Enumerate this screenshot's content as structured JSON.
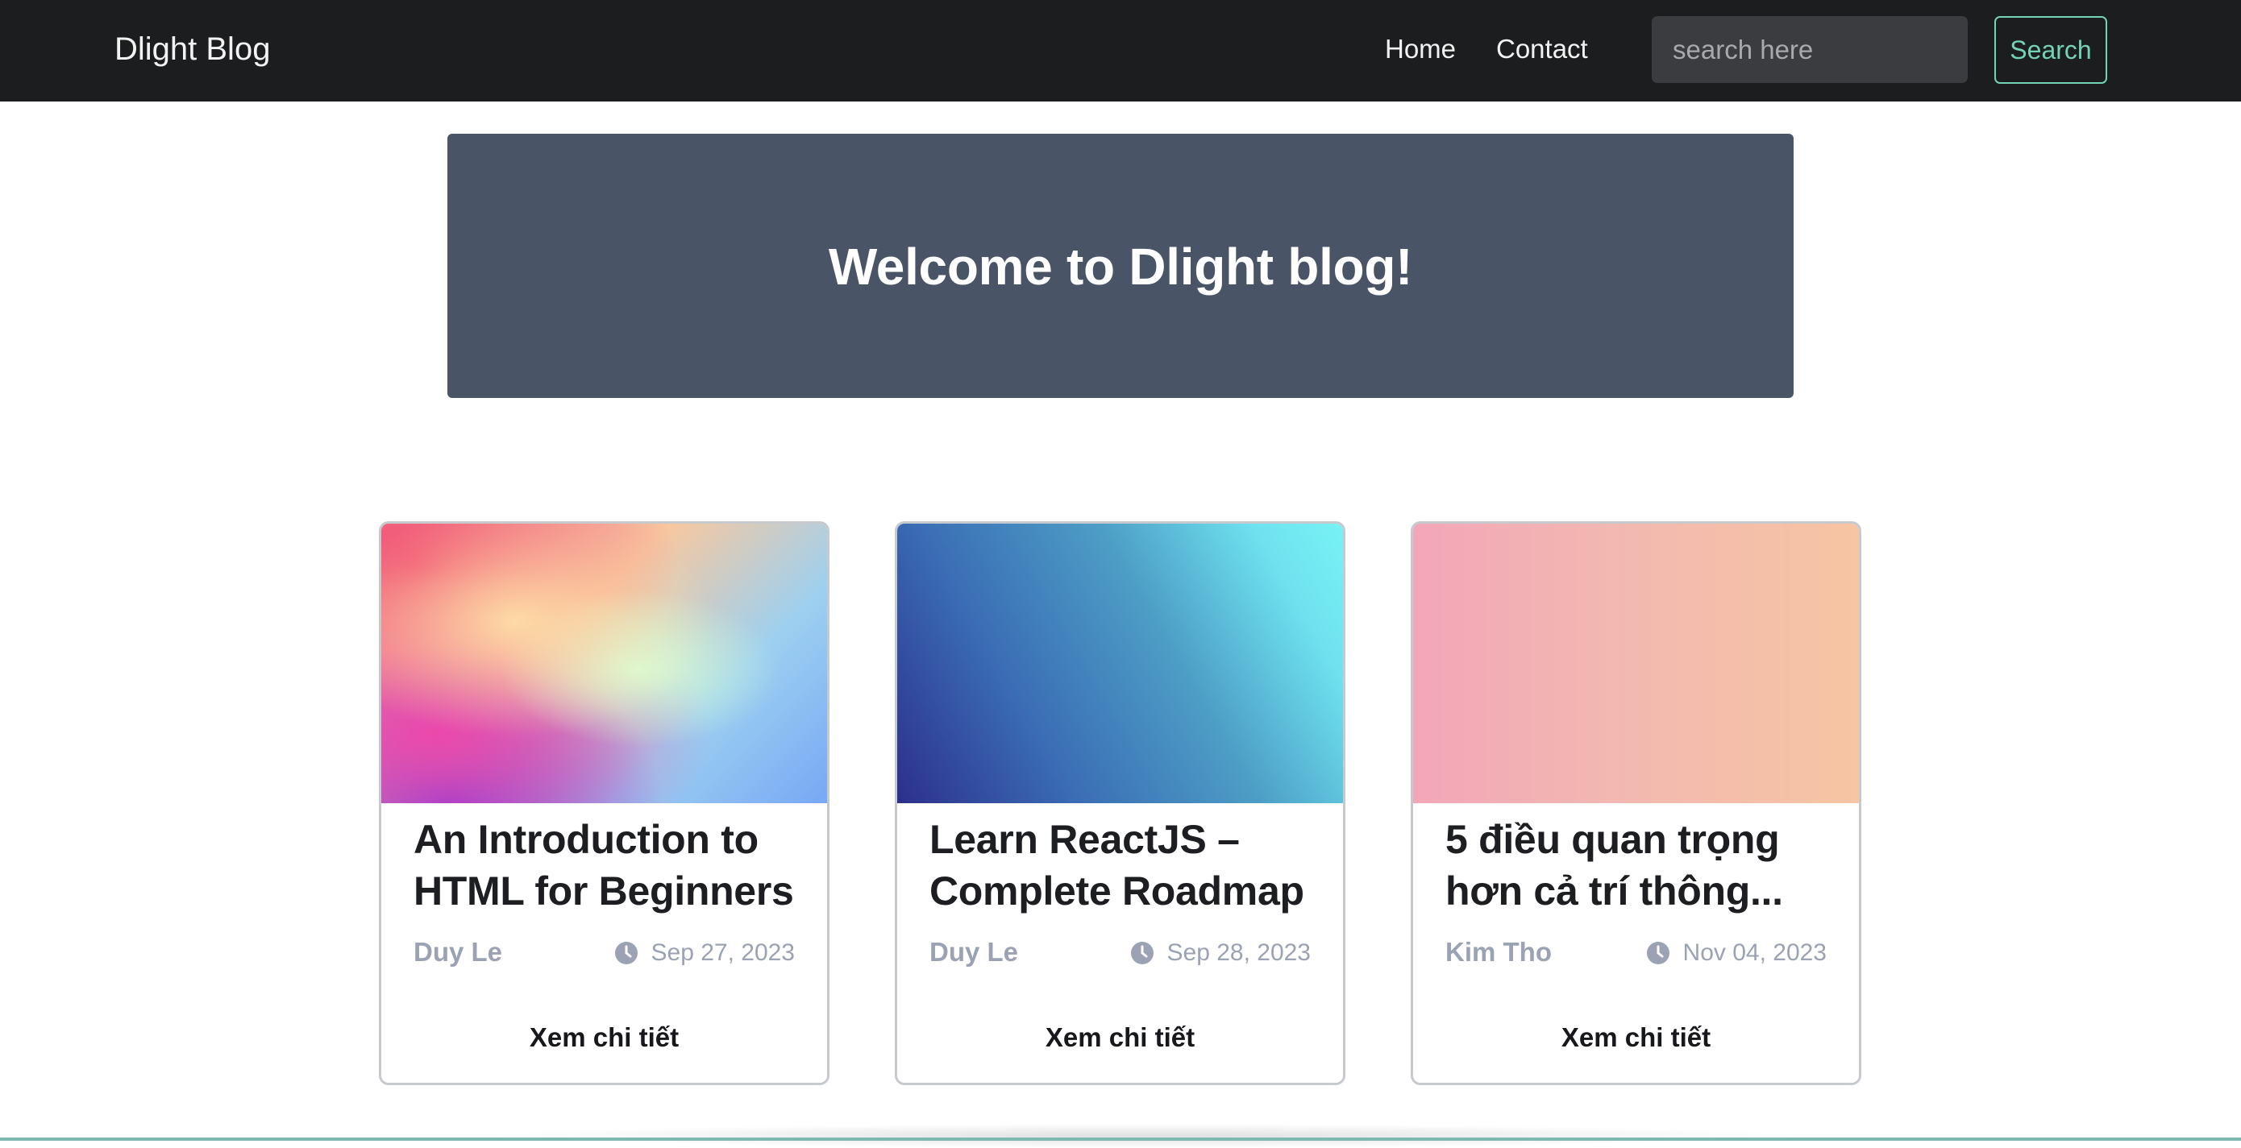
{
  "navbar": {
    "brand": "Dlight Blog",
    "links": [
      {
        "label": "Home"
      },
      {
        "label": "Contact"
      }
    ],
    "search": {
      "placeholder": "search here",
      "value": "",
      "button_label": "Search"
    }
  },
  "hero": {
    "title": "Welcome to Dlight blog!"
  },
  "posts": [
    {
      "title": "An Introduction to HTML for Beginners",
      "author": "Duy Le",
      "date": "Sep 27, 2023",
      "cta": "Xem chi tiết"
    },
    {
      "title": "Learn ReactJS – Complete Roadmap",
      "author": "Duy Le",
      "date": "Sep 28, 2023",
      "cta": "Xem chi tiết"
    },
    {
      "title": "5 điều quan trọng hơn cả trí thông...",
      "author": "Kim Tho",
      "date": "Nov 04, 2023",
      "cta": "Xem chi tiết"
    }
  ],
  "icons": {
    "date": "clock-icon"
  },
  "colors": {
    "navbar_bg": "#1c1d1f",
    "hero_bg": "#4a5467",
    "accent": "#74d3b3",
    "meta_text": "#9aa2b3"
  }
}
